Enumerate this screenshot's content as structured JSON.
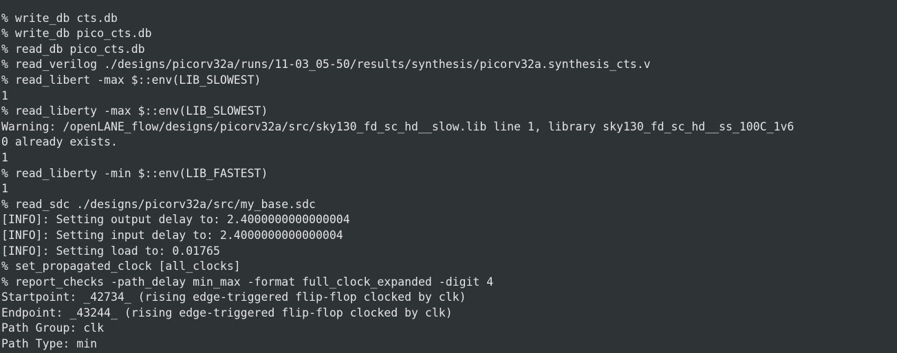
{
  "terminal": {
    "lines": [
      "% write_db cts.db",
      "% write_db pico_cts.db",
      "% read_db pico_cts.db",
      "% read_verilog ./designs/picorv32a/runs/11-03_05-50/results/synthesis/picorv32a.synthesis_cts.v",
      "% read_libert -max $::env(LIB_SLOWEST)",
      "1",
      "% read_liberty -max $::env(LIB_SLOWEST)",
      "Warning: /openLANE_flow/designs/picorv32a/src/sky130_fd_sc_hd__slow.lib line 1, library sky130_fd_sc_hd__ss_100C_1v6",
      "0 already exists.",
      "1",
      "% read_liberty -min $::env(LIB_FASTEST)",
      "1",
      "% read_sdc ./designs/picorv32a/src/my_base.sdc",
      "[INFO]: Setting output delay to: 2.4000000000000004",
      "[INFO]: Setting input delay to: 2.4000000000000004",
      "[INFO]: Setting load to: 0.01765",
      "% set_propagated_clock [all_clocks]",
      "% report_checks -path_delay min_max -format full_clock_expanded -digit 4",
      "Startpoint: _42734_ (rising edge-triggered flip-flop clocked by clk)",
      "Endpoint: _43244_ (rising edge-triggered flip-flop clocked by clk)",
      "Path Group: clk",
      "Path Type: min"
    ]
  }
}
